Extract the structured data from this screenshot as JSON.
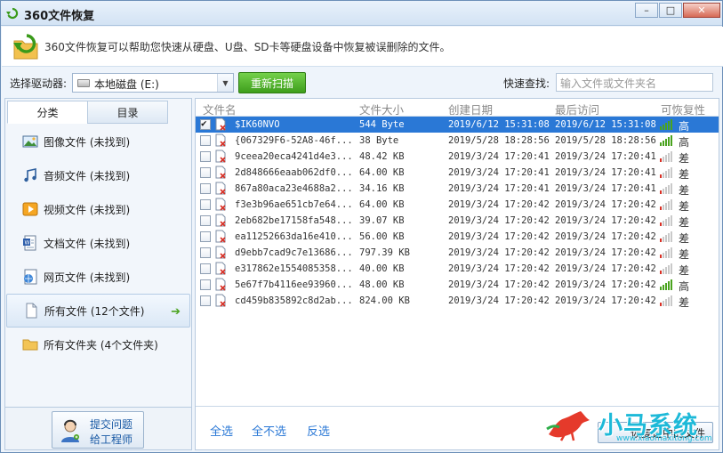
{
  "window": {
    "title": "360文件恢复"
  },
  "banner": {
    "text": "360文件恢复可以帮助您快速从硬盘、U盘、SD卡等硬盘设备中恢复被误删除的文件。"
  },
  "drive": {
    "label": "选择驱动器:",
    "selected": "本地磁盘 (E:)",
    "rescan_label": "重新扫描",
    "quick_search_label": "快速查找:",
    "quick_search_placeholder": "输入文件或文件夹名"
  },
  "tabs": [
    "分类",
    "目录"
  ],
  "categories": [
    {
      "icon": "image-icon",
      "label": "图像文件 (未找到)"
    },
    {
      "icon": "music-icon",
      "label": "音频文件 (未找到)"
    },
    {
      "icon": "video-icon",
      "label": "视频文件 (未找到)"
    },
    {
      "icon": "document-icon",
      "label": "文档文件 (未找到)"
    },
    {
      "icon": "webpage-icon",
      "label": "网页文件 (未找到)"
    },
    {
      "icon": "all-files-icon",
      "label": "所有文件 (12个文件)"
    },
    {
      "icon": "folder-icon",
      "label": "所有文件夹 (4个文件夹)"
    }
  ],
  "support": {
    "line1": "提交问题",
    "line2": "给工程师"
  },
  "table": {
    "columns": [
      "文件名",
      "文件大小",
      "创建日期",
      "最后访问",
      "可恢复性"
    ],
    "rows": [
      {
        "name": "$IK60NVO",
        "size": "544 Byte",
        "created": "2019/6/12 15:31:08",
        "accessed": "2019/6/12 15:31:08",
        "rank": "高",
        "level": "high",
        "checked": true
      },
      {
        "name": "{067329F6-52A8-46f...",
        "size": "38 Byte",
        "created": "2019/5/28 18:28:56",
        "accessed": "2019/5/28 18:28:56",
        "rank": "高",
        "level": "high",
        "checked": false
      },
      {
        "name": "9ceea20eca4241d4e3...",
        "size": "48.42 KB",
        "created": "2019/3/24 17:20:41",
        "accessed": "2019/3/24 17:20:41",
        "rank": "差",
        "level": "low",
        "checked": false
      },
      {
        "name": "2d848666eaab062df0...",
        "size": "64.00 KB",
        "created": "2019/3/24 17:20:41",
        "accessed": "2019/3/24 17:20:41",
        "rank": "差",
        "level": "low",
        "checked": false
      },
      {
        "name": "867a80aca23e4688a2...",
        "size": "34.16 KB",
        "created": "2019/3/24 17:20:41",
        "accessed": "2019/3/24 17:20:41",
        "rank": "差",
        "level": "low",
        "checked": false
      },
      {
        "name": "f3e3b96ae651cb7e64...",
        "size": "64.00 KB",
        "created": "2019/3/24 17:20:42",
        "accessed": "2019/3/24 17:20:42",
        "rank": "差",
        "level": "low",
        "checked": false
      },
      {
        "name": "2eb682be17158fa548...",
        "size": "39.07 KB",
        "created": "2019/3/24 17:20:42",
        "accessed": "2019/3/24 17:20:42",
        "rank": "差",
        "level": "low",
        "checked": false
      },
      {
        "name": "ea11252663da16e410...",
        "size": "56.00 KB",
        "created": "2019/3/24 17:20:42",
        "accessed": "2019/3/24 17:20:42",
        "rank": "差",
        "level": "low",
        "checked": false
      },
      {
        "name": "d9ebb7cad9c7e13686...",
        "size": "797.39 KB",
        "created": "2019/3/24 17:20:42",
        "accessed": "2019/3/24 17:20:42",
        "rank": "差",
        "level": "low",
        "checked": false
      },
      {
        "name": "e317862e1554085358...",
        "size": "40.00 KB",
        "created": "2019/3/24 17:20:42",
        "accessed": "2019/3/24 17:20:42",
        "rank": "差",
        "level": "low",
        "checked": false
      },
      {
        "name": "5e67f7b4116ee93960...",
        "size": "48.00 KB",
        "created": "2019/3/24 17:20:42",
        "accessed": "2019/3/24 17:20:42",
        "rank": "高",
        "level": "high",
        "checked": false
      },
      {
        "name": "cd459b835892c8d2ab...",
        "size": "824.00 KB",
        "created": "2019/3/24 17:20:42",
        "accessed": "2019/3/24 17:20:42",
        "rank": "差",
        "level": "low",
        "checked": false
      }
    ]
  },
  "actions": {
    "select_all": "全选",
    "select_none": "全不选",
    "invert": "反选",
    "recover": "恢复选中的文件"
  },
  "watermark": {
    "text": "小马系统",
    "url": "www.xiaomaxitong.com"
  },
  "colors": {
    "accent": "#2a78d6",
    "green": "#4aa31f",
    "red": "#d93025"
  }
}
